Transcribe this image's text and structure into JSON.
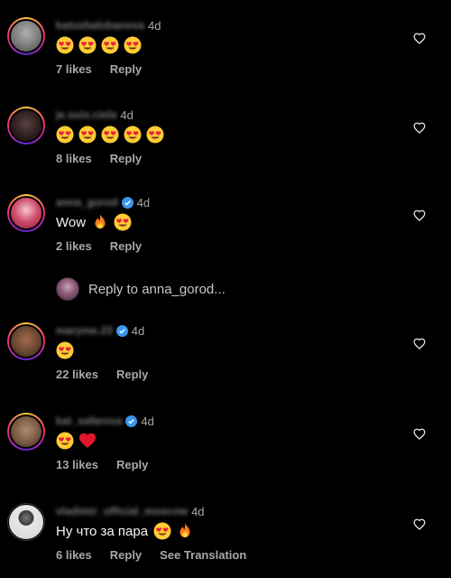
{
  "comments": [
    {
      "username": "katushalobanova",
      "verified": false,
      "time": "4d",
      "text": "",
      "emojis": [
        "heart-eyes",
        "heart-eyes",
        "heart-eyes",
        "heart-eyes"
      ],
      "likes": "7 likes",
      "reply": "Reply",
      "avatar_color": "#8a8a8a"
    },
    {
      "username": "je.suis.ciela",
      "verified": false,
      "time": "4d",
      "text": "",
      "emojis": [
        "heart-eyes",
        "heart-eyes",
        "heart-eyes",
        "heart-eyes",
        "heart-eyes"
      ],
      "likes": "8 likes",
      "reply": "Reply",
      "avatar_color": "#3a2a2a"
    },
    {
      "username": "anna_gorod",
      "verified": true,
      "time": "4d",
      "text": "Wow",
      "emojis": [
        "fire",
        "heart-eyes"
      ],
      "likes": "2 likes",
      "reply": "Reply",
      "avatar_color": "#d04a6a"
    },
    {
      "username": "maryme.23",
      "verified": true,
      "time": "4d",
      "text": "",
      "emojis": [
        "heart-eyes"
      ],
      "likes": "22 likes",
      "reply": "Reply",
      "avatar_color": "#6a4632"
    },
    {
      "username": "kat_safarova",
      "verified": true,
      "time": "4d",
      "text": "",
      "emojis": [
        "heart-eyes",
        "red-heart"
      ],
      "likes": "13 likes",
      "reply": "Reply",
      "avatar_color": "#7a5a44"
    },
    {
      "username": "vladimir_official_moscow",
      "verified": false,
      "time": "4d",
      "text": "Ну что за пара",
      "emojis": [
        "heart-eyes",
        "fire"
      ],
      "likes": "6 likes",
      "reply": "Reply",
      "translate": "See Translation",
      "avatar_color": "#c8c8c8"
    }
  ],
  "reply_thread": {
    "label": "Reply to anna_gorod..."
  },
  "colors": {
    "background": "#000000",
    "muted": "#a8a8a8",
    "verified": "#3897f0"
  }
}
